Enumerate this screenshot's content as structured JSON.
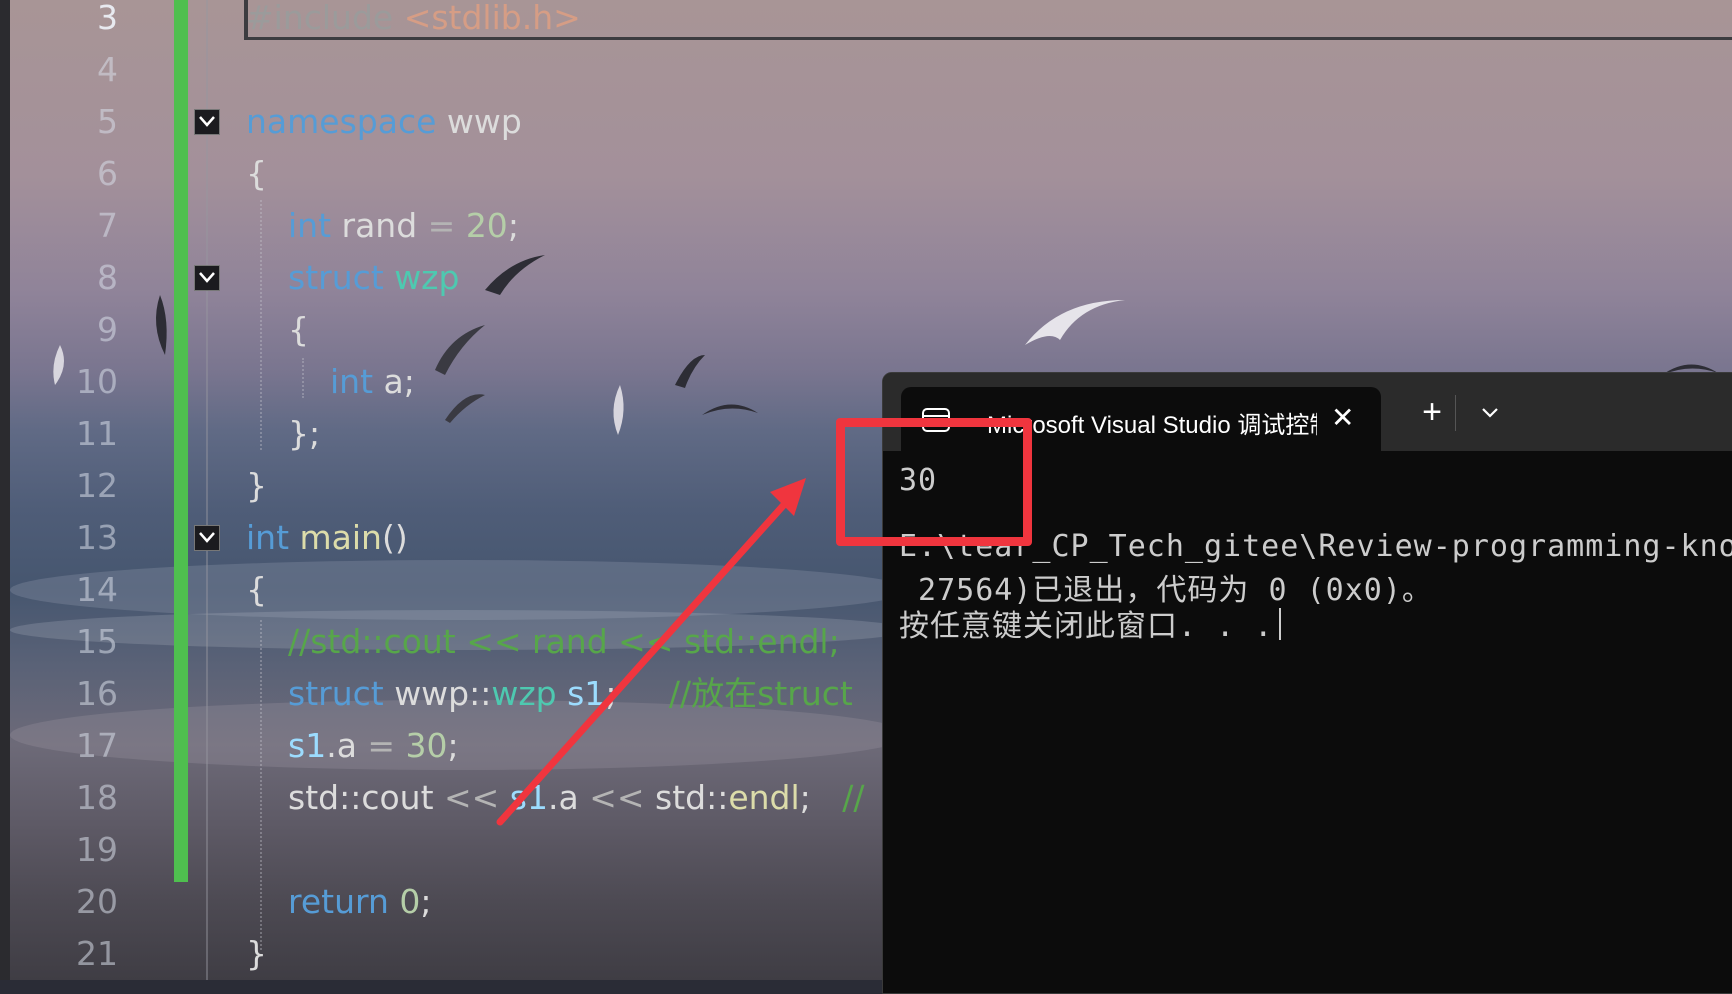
{
  "editor": {
    "line_numbers": [
      "3",
      "4",
      "5",
      "6",
      "7",
      "8",
      "9",
      "10",
      "11",
      "12",
      "13",
      "14",
      "15",
      "16",
      "17",
      "18",
      "19",
      "20",
      "21"
    ],
    "current_line": "3",
    "code": {
      "l3_a": "#include ",
      "l3_b": "<stdlib.h>",
      "l5_kw": "namespace",
      "l5_name": " wwp",
      "l6": "{",
      "l7_kw": "int",
      "l7_var": " rand ",
      "l7_op": "= ",
      "l7_num": "20",
      "l7_end": ";",
      "l8_kw": "struct",
      "l8_ty": " wzp",
      "l9": "{",
      "l10_kw": "int",
      "l10_var": " a;",
      "l11": "};",
      "l12": "}",
      "l13_kw": "int",
      "l13_fn": " main",
      "l13_end": "()",
      "l14": "{",
      "l15": "//std::cout << rand << std::endl;",
      "l16_kw": "struct",
      "l16_ns": " wwp::",
      "l16_ty": "wzp",
      "l16_var": " s1",
      "l16_end": ";",
      "l16_cm": "     //放在struct",
      "l17_var": "s1",
      "l17_mid": ".a ",
      "l17_op": "= ",
      "l17_num": "30",
      "l17_end": ";",
      "l18_a": "std::cout ",
      "l18_op1": "<< ",
      "l18_var": "s1",
      "l18_b": ".a ",
      "l18_op2": "<< ",
      "l18_c": "std::",
      "l18_fn": "endl",
      "l18_d": ";",
      "l18_cm": "   //",
      "l20_kw": "return",
      "l20_num": " 0",
      "l20_end": ";",
      "l21": "}"
    }
  },
  "console": {
    "tab_title": "Microsoft Visual Studio 调试控制台",
    "close_label": "✕",
    "new_tab_label": "+",
    "output": [
      "30",
      "",
      "E:\\tear_CP_Tech_gitee\\Review-programming-kno",
      " 27564)已退出，代码为 0 (0x0)。",
      "按任意键关闭此窗口. . ."
    ]
  },
  "colors": {
    "change_bar": "#4fbf4f",
    "annotation": "#f0353e",
    "keyword": "#569cd6",
    "type": "#4ec9b0",
    "number": "#b5cea8",
    "comment": "#57a64a"
  },
  "icons": {
    "fold": "chevron-down-icon",
    "console_tab": "terminal-icon",
    "dropdown": "chevron-down-icon"
  }
}
